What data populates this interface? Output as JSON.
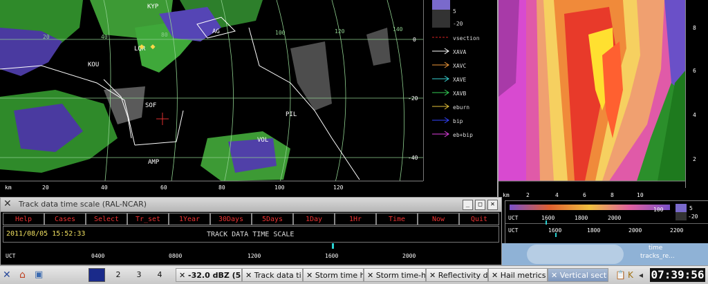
{
  "radar": {
    "station_labels": [
      {
        "text": "KYP"
      },
      {
        "text": "AG"
      },
      {
        "text": "LQR"
      },
      {
        "text": "KOU"
      },
      {
        "text": "SOF"
      },
      {
        "text": "PIL"
      },
      {
        "text": "VOL"
      },
      {
        "text": "AMP"
      }
    ],
    "ring_labels": [
      "40",
      "80",
      "100",
      "120",
      "140",
      "20"
    ],
    "x_axis_unit": "km",
    "x_ticks": [
      "20",
      "40",
      "60",
      "80",
      "100",
      "120"
    ],
    "y_ticks": [
      "0",
      "-20",
      "-40"
    ]
  },
  "legend": {
    "scale_top": "5",
    "scale_bottom": "-20",
    "items": [
      {
        "label": "vsection",
        "color": "#d22"
      },
      {
        "label": "XAVA",
        "color": "#ffffff"
      },
      {
        "label": "XAVC",
        "color": "#f29a3a"
      },
      {
        "label": "XAVE",
        "color": "#39d3d3"
      },
      {
        "label": "XAVB",
        "color": "#33cc55"
      },
      {
        "label": "eburn",
        "color": "#e6c23a"
      },
      {
        "label": "bip",
        "color": "#3344ff"
      },
      {
        "label": "eb+bip",
        "color": "#e040e0"
      }
    ]
  },
  "cross_section": {
    "x_unit": "km",
    "x_ticks": [
      "2",
      "4",
      "6",
      "8",
      "10"
    ],
    "y_ticks": [
      "8",
      "6",
      "4",
      "2"
    ]
  },
  "mini_timeline": {
    "value_top": "100",
    "scale_top": "5",
    "scale_bottom": "-20",
    "row1_label": "UCT",
    "row1_ticks": [
      "1600",
      "1800",
      "2000"
    ],
    "row2_label": "UCT",
    "row2_ticks": [
      "1600",
      "1800",
      "2000",
      "2200"
    ]
  },
  "desktop": {
    "icon_label_1": "time",
    "icon_label_2": "tracks_re..."
  },
  "track_window": {
    "title": "Track data time scale (RAL-NCAR)",
    "buttons": [
      "Help",
      "Cases",
      "Select",
      "Tr_set",
      "1Year",
      "30Days",
      "5Days",
      "1Day",
      "1Hr",
      "Time",
      "Now",
      "Quit"
    ],
    "datetime": "2011/08/05 15:52:33",
    "heading": "TRACK DATA TIME SCALE",
    "axis_label": "UCT",
    "ticks": [
      "0400",
      "0800",
      "1200",
      "1600",
      "2000"
    ]
  },
  "taskbar": {
    "workspaces": [
      "2",
      "3",
      "4"
    ],
    "tasks": [
      {
        "label": "-32.0 dBZ (5"
      },
      {
        "label": "Track data ti"
      },
      {
        "label": "Storm time h"
      },
      {
        "label": "Storm time-h"
      },
      {
        "label": "Reflectivity d"
      },
      {
        "label": "Hail metrics"
      },
      {
        "label": "Vertical sect"
      }
    ],
    "clock": "07:39:56"
  }
}
